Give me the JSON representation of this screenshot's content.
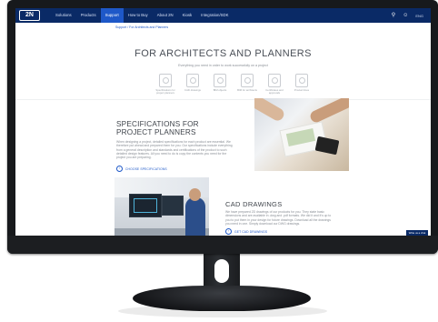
{
  "nav": {
    "logo": "2N",
    "items": [
      "Solutions",
      "Products",
      "Support",
      "How to Buy",
      "About 2N",
      "Kiosk",
      "Integration/SDK"
    ],
    "active_index": 2,
    "lang": "ENG"
  },
  "breadcrumb": "Support / For Architects and Planners",
  "hero": {
    "title": "FOR ARCHITECTS AND PLANNERS",
    "subtitle": "Everything you need in order to work successfully on a project"
  },
  "icons": [
    {
      "name": "specifications-icon",
      "label": "Specifications for project planners"
    },
    {
      "name": "cad-icon",
      "label": "CAD drawings"
    },
    {
      "name": "bim-icon",
      "label": "BIM objects"
    },
    {
      "name": "ifc-icon",
      "label": "BIM for architects"
    },
    {
      "name": "certificates-icon",
      "label": "Certificates and approvals"
    },
    {
      "name": "product-list-icon",
      "label": "Product lines"
    }
  ],
  "section_specs": {
    "title": "SPECIFICATIONS FOR PROJECT PLANNERS",
    "text": "When designing a project, detailed specifications for each product are essential. We therefore put ahead and prepared them for you. Our specifications include everything from a general description and standards and certifications of the product to such detailed design features. All you need to do is copy the contents you need for the project you are preparing.",
    "cta": "CHOOSE SPECIFICATIONS"
  },
  "section_cad": {
    "title": "CAD DRAWINGS",
    "text": "We have prepared 2D drawings of our products for you. They state basic dimensions and are available in .dwg and .pdf formats. We did it and it's up to you to put them in your design for future drawings. Download all the drawings you need in one. Simply download our DWG drawings.",
    "cta": "GET CAD DRAWINGS"
  },
  "chat_label": "Write us a chat",
  "colors": {
    "nav_bg": "#0a2a66",
    "accent": "#1e58c8",
    "monitor": "#17191c"
  }
}
